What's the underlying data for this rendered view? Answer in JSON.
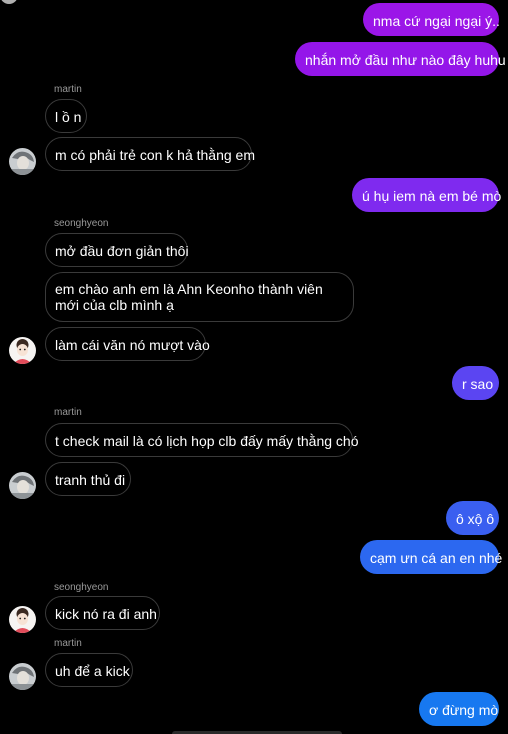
{
  "messages": [
    {
      "text": "nma cứ ngại ngại ý.."
    },
    {
      "text": "nhắn mở đầu như nào đây huhu"
    },
    {
      "sender": "martin"
    },
    {
      "text": "l ồ n"
    },
    {
      "text": "m có phải trẻ con k hả thằng em"
    },
    {
      "text": "ú hụ iem nà em bé mò"
    },
    {
      "sender": "seonghyeon"
    },
    {
      "text": "mở đầu đơn giản thôi"
    },
    {
      "text": "em chào anh em là Ahn Keonho thành viên mới của clb mình ạ"
    },
    {
      "text": "làm cái văn nó mượt vào"
    },
    {
      "text": "r sao"
    },
    {
      "sender": "martin"
    },
    {
      "text": "t check mail là có lịch họp clb đấy mấy thằng chó"
    },
    {
      "text": "tranh thủ đi"
    },
    {
      "text": "ô xộ ô"
    },
    {
      "text": "cạm ưn cá an en nhé"
    },
    {
      "sender": "seonghyeon"
    },
    {
      "text": "kick nó ra đi anh"
    },
    {
      "sender": "martin"
    },
    {
      "text": "uh để a kick"
    },
    {
      "text": "ơ đừng mò"
    }
  ],
  "colors": {
    "incoming_border": "#3a3a3a",
    "background": "#000000",
    "outgoing_gradient": [
      "#9b16e8",
      "#7a2ff0",
      "#5c44f2",
      "#3a5ff0",
      "#1778f0"
    ]
  }
}
